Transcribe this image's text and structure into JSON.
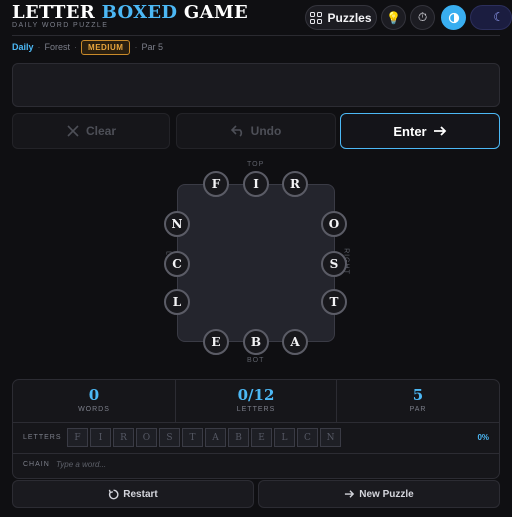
{
  "header": {
    "title_part1": "LETTER",
    "title_accent": "BOXED",
    "title_part2": "GAME",
    "subtitle": "DAILY WORD PUZZLE",
    "puzzles_label": "Puzzles"
  },
  "meta": {
    "mode": "Daily",
    "theme": "Forest",
    "difficulty": "MEDIUM",
    "par": "Par 5"
  },
  "word_input": {
    "value": ""
  },
  "actions": {
    "clear_label": "Clear",
    "undo_label": "Undo",
    "enter_label": "Enter"
  },
  "board": {
    "side_labels": {
      "top": "TOP",
      "bottom": "BOT",
      "left": "LEFT",
      "right": "RIGHT"
    },
    "top": [
      "F",
      "I",
      "R"
    ],
    "right": [
      "O",
      "S",
      "T"
    ],
    "bottom": [
      "E",
      "B",
      "A"
    ],
    "left": [
      "N",
      "C",
      "L"
    ]
  },
  "stats": {
    "words": {
      "value": "0",
      "label": "WORDS"
    },
    "letters": {
      "value": "0/12",
      "label": "LETTERS"
    },
    "par": {
      "value": "5",
      "label": "PAR"
    }
  },
  "letters_row": {
    "label": "LETTERS",
    "tiles": [
      "F",
      "I",
      "R",
      "O",
      "S",
      "T",
      "A",
      "B",
      "E",
      "L",
      "C",
      "N"
    ],
    "percent": "0%"
  },
  "chain_row": {
    "label": "CHAIN",
    "placeholder": "Type a word..."
  },
  "footer": {
    "restart_label": "Restart",
    "new_puzzle_label": "New Puzzle"
  },
  "colors": {
    "accent": "#4cb8f5",
    "difficulty_badge": "#e9a53c",
    "background": "#0f0f12"
  }
}
